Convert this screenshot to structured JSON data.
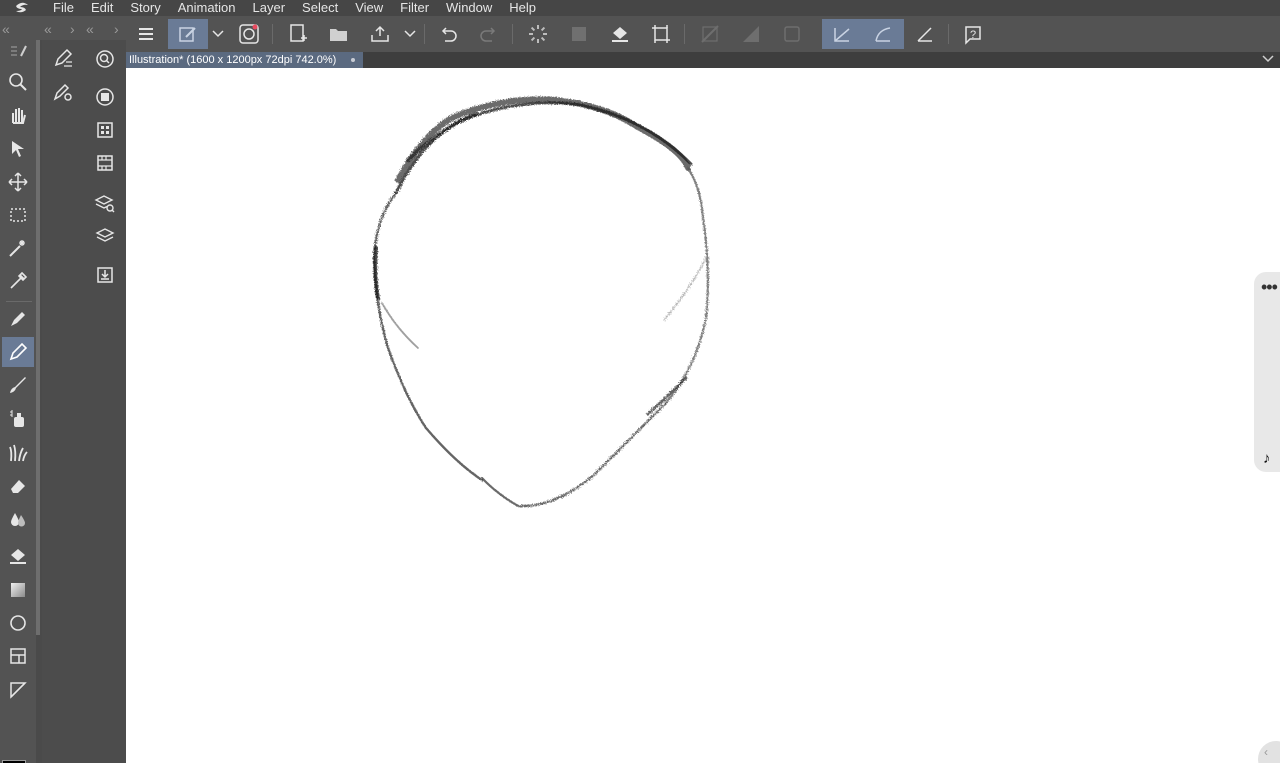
{
  "menu": [
    "File",
    "Edit",
    "Story",
    "Animation",
    "Layer",
    "Select",
    "View",
    "Filter",
    "Window",
    "Help"
  ],
  "document_tab": {
    "title": "Illustration* (1600 x 1200px 72dpi 742.0%)"
  },
  "colors": {
    "main_color": "#000000",
    "sub_color": "#86e6f6",
    "accent": "#6a7b96",
    "panel": "#535353"
  },
  "command_bar_icons": [
    "menu-icon",
    "edit-pencil-icon",
    "chevron-down-icon",
    "clip-studio-icon",
    "new-file-icon",
    "open-folder-icon",
    "export-tray-icon",
    "chevron-down-icon",
    "undo-icon",
    "redo-icon",
    "loading-spinner-icon",
    "selection-layer-icon",
    "fill-icon",
    "transform-icon",
    "snap-ruler-icon",
    "snap-special-ruler-icon",
    "snap-grid-icon",
    "stabilizer-icon",
    "curve-stabilizer-icon",
    "ruler-pen-icon",
    "help-icon"
  ],
  "tools": [
    "zoom-icon",
    "hand-icon",
    "operation-icon",
    "move-layer-icon",
    "selection-rect-icon",
    "auto-select-wand-icon",
    "eyedropper-icon",
    "pen-icon",
    "pencil-icon",
    "brush-icon",
    "airbrush-icon",
    "decoration-icon",
    "eraser-icon",
    "blend-icon",
    "fill-bucket-icon",
    "gradient-icon",
    "figure-circle-icon",
    "frame-border-icon",
    "ruler-icon"
  ],
  "sub_tools": [
    "sub-tool-detail-icon",
    "sub-tool-settings-icon"
  ],
  "panels": [
    "navigator-icon",
    "layer-property-icon",
    "material-icon",
    "animation-cels-icon",
    "layer-search-icon",
    "layer-icon",
    "import-icon"
  ]
}
